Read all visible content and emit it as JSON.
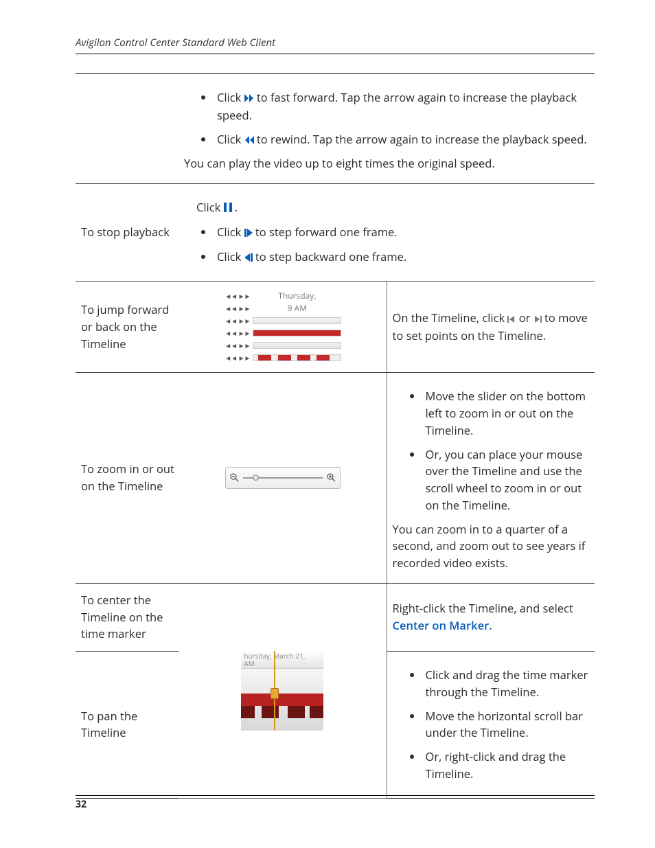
{
  "header": {
    "running_title": "Avigilon Control Center Standard Web Client"
  },
  "footer": {
    "page_number": "32"
  },
  "icons": {
    "fast_forward": "fast-forward-icon",
    "rewind": "rewind-icon",
    "pause": "pause-icon",
    "step_forward": "step-forward-icon",
    "step_backward": "step-backward-icon",
    "jump_back": "jump-back-icon",
    "jump_forward": "jump-forward-icon",
    "zoom_out": "zoom-out-icon",
    "zoom_in": "zoom-in-icon"
  },
  "rows": {
    "r1": {
      "b1_pre": "Click ",
      "b1_post": " to fast forward. Tap the arrow again to increase the playback speed.",
      "b2_pre": "Click ",
      "b2_post": " to rewind. Tap the arrow again to increase the playback speed.",
      "note": "You can play the video up to eight times the original speed."
    },
    "r2": {
      "label": "To stop playback",
      "lead_pre": "Click ",
      "lead_post": ".",
      "b1_pre": "Click ",
      "b1_post": " to step forward one frame.",
      "b2_pre": "Click ",
      "b2_post": " to step backward one frame."
    },
    "r3": {
      "label": "To jump forward or back on the Timeline",
      "thumb_day": "Thursday,",
      "thumb_time": "9 AM",
      "desc_pre": "On the Timeline, click ",
      "desc_mid": " or ",
      "desc_post": " to move to set points on the Timeline."
    },
    "r4": {
      "label": "To zoom in or out on the Timeline",
      "b1": "Move the slider on the bottom left to zoom in or out on the Timeline.",
      "b2": "Or, you can place your mouse over the Timeline and use the scroll wheel to zoom in or out on the Timeline.",
      "note": "You can zoom in to a quarter of a second, and zoom out to see years if recorded video exists."
    },
    "r5": {
      "label": "To center the Timeline on the time marker",
      "desc_pre": "Right-click the Timeline, and select ",
      "desc_link": "Center on Marker."
    },
    "r6": {
      "label": "To pan the Timeline",
      "thumb_date": "hursday, March 21,",
      "thumb_am": "AM",
      "b1": "Click and drag the time marker through the Timeline.",
      "b2": "Move the horizontal scroll bar under the Timeline.",
      "b3": "Or, right-click and drag the Timeline."
    }
  }
}
